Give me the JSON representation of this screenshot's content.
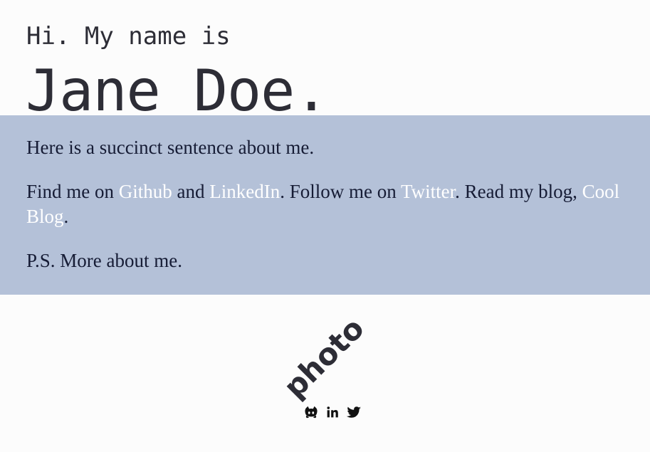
{
  "header": {
    "intro": "Hi. My name is",
    "name": "Jane Doe."
  },
  "about": {
    "sentence": "Here is a succinct sentence about me.",
    "find_prefix": "Find me on ",
    "github_link": "Github",
    "and_text": " and ",
    "linkedin_link": "LinkedIn",
    "follow_text": ". Follow me on ",
    "twitter_link": "Twitter",
    "read_text": ". Read my blog, ",
    "blog_link": "Cool Blog",
    "period": ".",
    "ps": "P.S. More about me."
  },
  "photo": {
    "label": "photo"
  },
  "social": {
    "icons": [
      "github-icon",
      "linkedin-icon",
      "twitter-icon"
    ]
  },
  "colors": {
    "background": "#fcfcfc",
    "band": "#b4c1d8",
    "text_dark": "#2d2d36",
    "text_body": "#161c35",
    "link": "#ffffff"
  }
}
